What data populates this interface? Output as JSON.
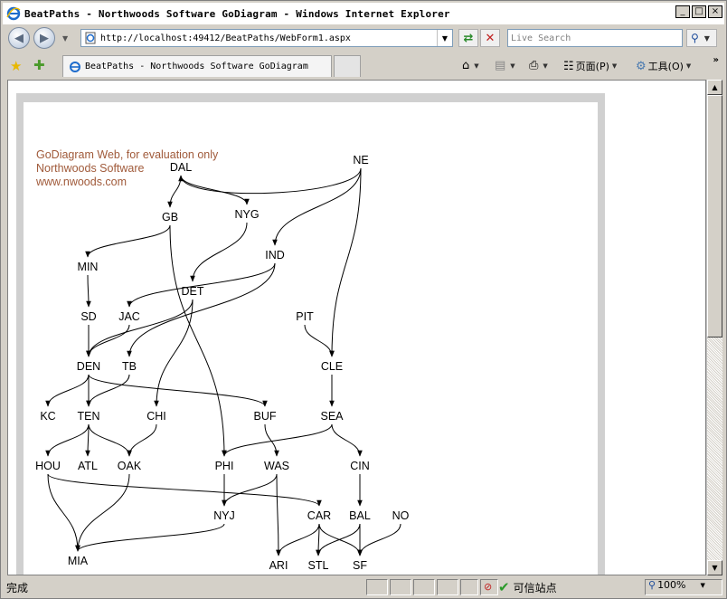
{
  "window": {
    "title": "BeatPaths - Northwoods Software GoDiagram - Windows Internet Explorer",
    "minimize_label": "_",
    "maximize_label": "□",
    "close_label": "×"
  },
  "address_bar": {
    "url": "http://localhost:49412/BeatPaths/WebForm1.aspx"
  },
  "search": {
    "placeholder": "Live Search"
  },
  "tab": {
    "label": "BeatPaths - Northwoods Software GoDiagram"
  },
  "command_bar": {
    "page_label": "页面(P)",
    "tools_label": "工具(O)"
  },
  "diagram": {
    "watermark": [
      "GoDiagram Web, for evaluation only",
      "Northwoods Software",
      "www.nwoods.com"
    ],
    "nodes": [
      "DAL",
      "NE",
      "GB",
      "NYG",
      "IND",
      "MIN",
      "DET",
      "SD",
      "JAC",
      "PIT",
      "DEN",
      "TB",
      "CLE",
      "KC",
      "TEN",
      "CHI",
      "BUF",
      "SEA",
      "HOU",
      "ATL",
      "OAK",
      "PHI",
      "WAS",
      "CIN",
      "NYJ",
      "CAR",
      "BAL",
      "NO",
      "MIA",
      "ARI",
      "STL",
      "SF"
    ],
    "edges": [
      [
        "NE",
        "DAL"
      ],
      [
        "NE",
        "IND"
      ],
      [
        "NE",
        "CLE"
      ],
      [
        "DAL",
        "GB"
      ],
      [
        "DAL",
        "NYG"
      ],
      [
        "GB",
        "MIN"
      ],
      [
        "GB",
        "PHI"
      ],
      [
        "NYG",
        "DET"
      ],
      [
        "IND",
        "JAC"
      ],
      [
        "IND",
        "TB"
      ],
      [
        "MIN",
        "SD"
      ],
      [
        "DET",
        "DEN"
      ],
      [
        "DET",
        "CHI"
      ],
      [
        "SD",
        "DEN"
      ],
      [
        "JAC",
        "DEN"
      ],
      [
        "PIT",
        "CLE"
      ],
      [
        "DEN",
        "KC"
      ],
      [
        "DEN",
        "TEN"
      ],
      [
        "DEN",
        "BUF"
      ],
      [
        "TB",
        "TEN"
      ],
      [
        "CLE",
        "SEA"
      ],
      [
        "TEN",
        "HOU"
      ],
      [
        "TEN",
        "ATL"
      ],
      [
        "TEN",
        "OAK"
      ],
      [
        "CHI",
        "OAK"
      ],
      [
        "BUF",
        "WAS"
      ],
      [
        "SEA",
        "PHI"
      ],
      [
        "SEA",
        "CIN"
      ],
      [
        "HOU",
        "CAR"
      ],
      [
        "HOU",
        "MIA"
      ],
      [
        "OAK",
        "MIA"
      ],
      [
        "PHI",
        "NYJ"
      ],
      [
        "WAS",
        "NYJ"
      ],
      [
        "WAS",
        "ARI"
      ],
      [
        "CIN",
        "BAL"
      ],
      [
        "NYJ",
        "MIA"
      ],
      [
        "CAR",
        "ARI"
      ],
      [
        "CAR",
        "STL"
      ],
      [
        "CAR",
        "SF"
      ],
      [
        "BAL",
        "STL"
      ],
      [
        "BAL",
        "SF"
      ],
      [
        "NO",
        "SF"
      ]
    ]
  },
  "status_bar": {
    "status_text": "完成",
    "zone_label": "可信站点",
    "zoom_label": "100%"
  },
  "icons": {
    "browser": "ie-logo-icon",
    "back": "back-arrow-icon",
    "forward": "forward-arrow-icon",
    "refresh": "refresh-icon",
    "stop": "stop-icon",
    "search": "magnifier-icon",
    "favorites": "star-icon",
    "add_favorites": "add-favorites-icon",
    "home": "home-icon",
    "feeds": "rss-feed-icon",
    "print": "printer-icon",
    "page": "page-icon",
    "tools": "gear-icon"
  },
  "colors": {
    "watermark": "#a05a3a",
    "frame": "#d0d0d0",
    "chrome": "#d4d0c8"
  }
}
